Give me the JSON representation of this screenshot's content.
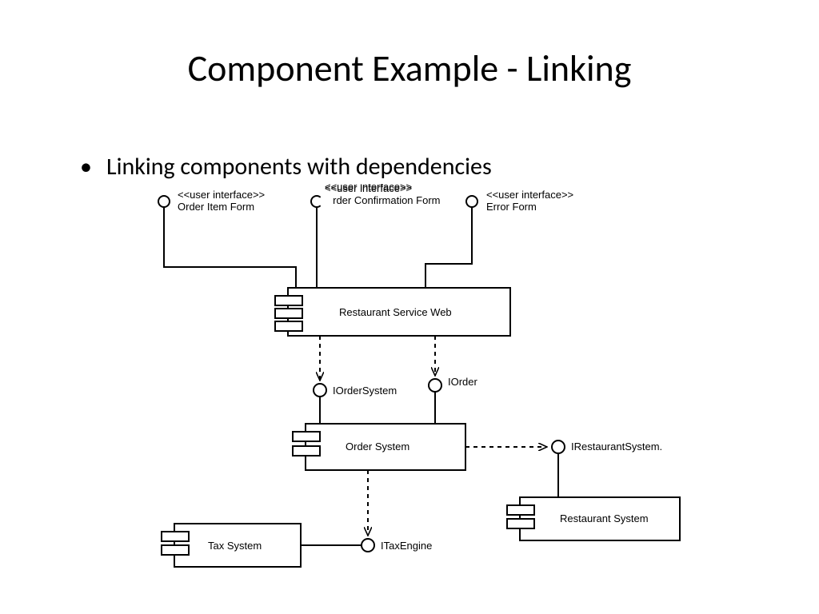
{
  "title": "Component Example - Linking",
  "bullet": "Linking components with dependencies",
  "interfaces": {
    "orderItemForm": {
      "stereo": "<<user interface>>",
      "name": "Order Item Form"
    },
    "orderConfForm": {
      "stereo": "<<user interface>>",
      "name": "Order Confirmation Form"
    },
    "errorForm": {
      "stereo": "<<user interface>>",
      "name": "Error Form"
    },
    "iOrderSystem": {
      "name": "IOrderSystem"
    },
    "iOrder": {
      "name": "IOrder"
    },
    "iTaxEngine": {
      "name": "ITaxEngine"
    },
    "iRestaurantSystem": {
      "name": "IRestaurantSystem."
    }
  },
  "components": {
    "restaurantServiceWeb": "Restaurant Service Web",
    "orderSystem": "Order System",
    "taxSystem": "Tax System",
    "restaurantSystem": "Restaurant System"
  }
}
